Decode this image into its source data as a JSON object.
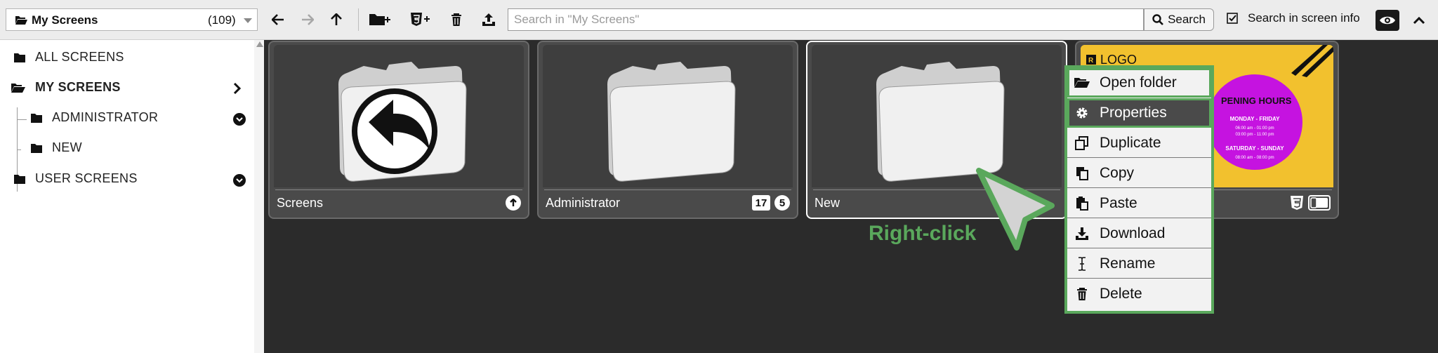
{
  "toolbar": {
    "folder_name": "My Screens",
    "folder_count": "(109)",
    "search_placeholder": "Search in \"My Screens\"",
    "search_button": "Search",
    "search_in_info_label": "Search in screen info",
    "icons": [
      "folder-open-icon",
      "back-arrow-icon",
      "forward-arrow-icon",
      "up-arrow-icon",
      "new-folder-icon",
      "new-html5-icon",
      "trash-icon",
      "upload-icon",
      "search-icon",
      "checkbox-icon",
      "eye-icon",
      "chevron-up-icon"
    ]
  },
  "sidebar": {
    "items": [
      {
        "label": "ALL SCREENS"
      },
      {
        "label": "MY SCREENS"
      },
      {
        "label": "ADMINISTRATOR"
      },
      {
        "label": "NEW"
      },
      {
        "label": "USER SCREENS"
      }
    ]
  },
  "tiles": [
    {
      "name": "Screens",
      "badges": []
    },
    {
      "name": "Administrator",
      "badges": [
        "17",
        "5"
      ]
    },
    {
      "name": "New",
      "badges": []
    },
    {
      "name": "",
      "badges": []
    }
  ],
  "preview": {
    "logo": "LOGO",
    "title": "PENING HOURS",
    "weekday_label": "MONDAY - FRIDAY",
    "weekday_line1": "06:00 am - 01:00 pm",
    "weekday_line2": "03:00 pm - 11:00 pm",
    "weekend_label": "SATURDAY - SUNDAY",
    "weekend_line1": "08:00 am - 08:00 pm"
  },
  "context_menu": {
    "items": [
      {
        "label": "Open folder",
        "icon": "folder-open-icon"
      },
      {
        "label": "Properties",
        "icon": "gear-icon"
      },
      {
        "label": "Duplicate",
        "icon": "duplicate-icon"
      },
      {
        "label": "Copy",
        "icon": "copy-icon"
      },
      {
        "label": "Paste",
        "icon": "paste-icon"
      },
      {
        "label": "Download",
        "icon": "download-icon"
      },
      {
        "label": "Rename",
        "icon": "text-cursor-icon"
      },
      {
        "label": "Delete",
        "icon": "trash-icon"
      }
    ]
  },
  "annotation": {
    "label": "Right-click",
    "color": "#5aa85c"
  },
  "colors": {
    "accent_green": "#5aa85c",
    "preview_yellow": "#f2c12e",
    "preview_purple": "#c513e0"
  }
}
